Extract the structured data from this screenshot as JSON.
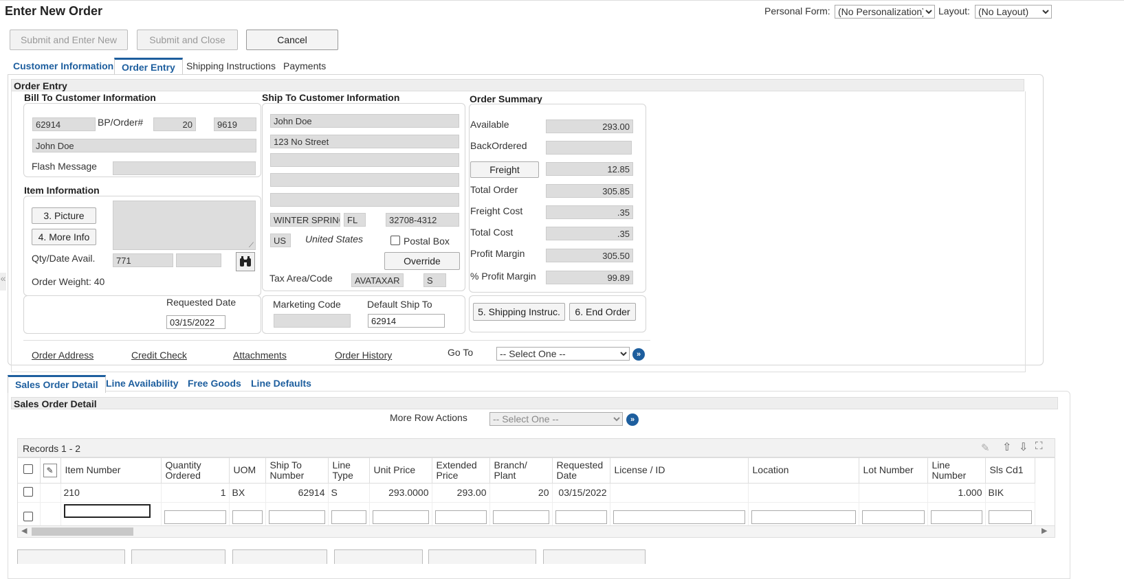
{
  "header": {
    "title": "Enter New Order",
    "personal_form_label": "Personal Form:",
    "personal_form_value": "(No Personalization)",
    "layout_label": "Layout:",
    "layout_value": "(No Layout)"
  },
  "toolbar": {
    "submit_enter_new": "Submit and Enter New",
    "submit_close": "Submit and Close",
    "cancel": "Cancel"
  },
  "tabs": [
    "Customer Information",
    "Order Entry",
    "Shipping Instructions",
    "Payments"
  ],
  "order_entry": {
    "section_title": "Order Entry",
    "bill_to": {
      "heading": "Bill To Customer Information",
      "customer_no": "62914",
      "bp_order_label": "BP/Order#",
      "bp": "20",
      "order": "9619",
      "name": "John Doe",
      "flash_message_label": "Flash Message",
      "flash_message": ""
    },
    "item_info": {
      "heading": "Item Information",
      "picture_button": "3. Picture",
      "more_info_button": "4. More Info",
      "qty_date_label": "Qty/Date Avail.",
      "qty_value": "771",
      "date_value": "",
      "order_weight": "Order Weight: 40"
    },
    "requested": {
      "label": "Requested Date",
      "value": "03/15/2022"
    },
    "ship_to": {
      "heading": "Ship To Customer Information",
      "name": "John Doe",
      "address1": "123 No Street",
      "address2": "",
      "address3": "",
      "address4": "",
      "city": "WINTER SPRINGS",
      "state": "FL",
      "zip": "32708-4312",
      "country_code": "US",
      "country": "United States",
      "postal_box_label": "Postal Box",
      "override_button": "Override",
      "tax_label": "Tax Area/Code",
      "tax_area": "AVATAXAR",
      "tax_code": "S"
    },
    "marketing": {
      "marketing_label": "Marketing Code",
      "marketing_value": "",
      "default_ship_label": "Default Ship To",
      "default_ship_value": "62914"
    },
    "summary": {
      "heading": "Order Summary",
      "available_label": "Available",
      "available": "293.00",
      "backordered_label": "BackOrdered",
      "backordered": "",
      "freight_button": "Freight",
      "freight": "12.85",
      "total_order_label": "Total Order",
      "total_order": "305.85",
      "freight_cost_label": "Freight Cost",
      "freight_cost": ".35",
      "total_cost_label": "Total Cost",
      "total_cost": ".35",
      "profit_margin_label": "Profit Margin",
      "profit_margin": "305.50",
      "pct_profit_label": "% Profit Margin",
      "pct_profit": "99.89",
      "shipping_instr_button": "5. Shipping Instruc.",
      "end_order_button": "6. End Order"
    },
    "links": [
      "Order Address",
      "Credit Check",
      "Attachments",
      "Order History"
    ],
    "goto_label": "Go To",
    "goto_value": "-- Select One --"
  },
  "detail_tabs": [
    "Sales Order Detail",
    "Line Availability",
    "Free Goods",
    "Line Defaults"
  ],
  "detail": {
    "section_title": "Sales Order Detail",
    "more_row_actions_label": "More Row Actions",
    "more_row_actions_value": "-- Select One --",
    "records": "Records 1 - 2",
    "columns": [
      "Item Number",
      "Quantity Ordered",
      "UOM",
      "Ship To Number",
      "Line Type",
      "Unit Price",
      "Extended Price",
      "Branch/ Plant",
      "Requested Date",
      "License / ID",
      "Location",
      "Lot Number",
      "Line Number",
      "Sls Cd1"
    ],
    "rows": [
      [
        "210",
        "1",
        "BX",
        "62914",
        "S",
        "293.0000",
        "293.00",
        "20",
        "03/15/2022",
        "",
        "",
        "",
        "1.000",
        "BIK"
      ]
    ]
  }
}
